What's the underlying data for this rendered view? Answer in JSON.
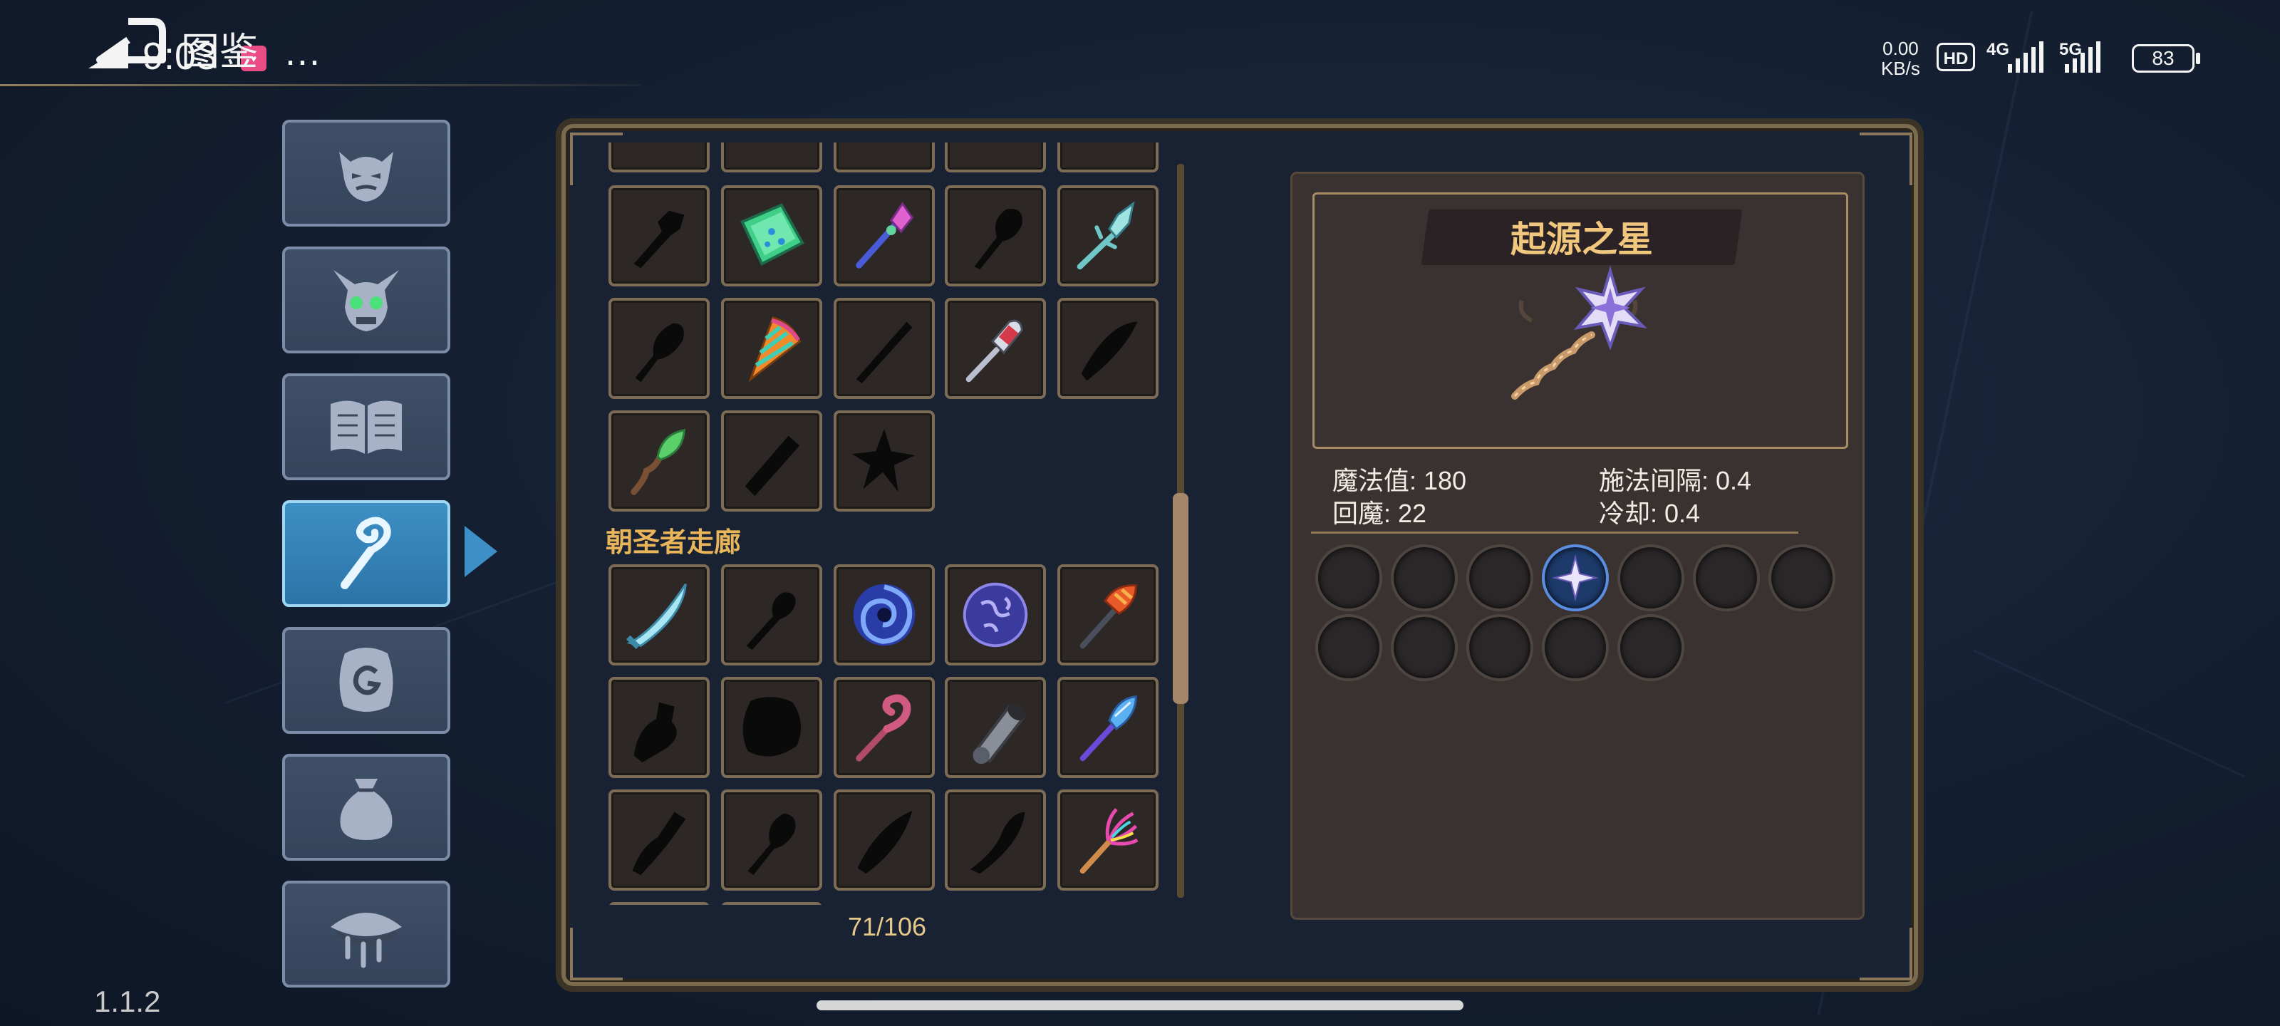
{
  "status_bar": {
    "time": "9:03",
    "dots": "...",
    "net_speed_value": "0.00",
    "net_speed_unit": "KB/s",
    "hd_badge": "HD",
    "sig1": "4G",
    "sig2": "5G",
    "battery": "83"
  },
  "header": {
    "title": "图鉴"
  },
  "version": "1.1.2",
  "tabs": [
    {
      "icon": "demon-face-icon",
      "active": false
    },
    {
      "icon": "horned-skull-icon",
      "active": false
    },
    {
      "icon": "open-book-icon",
      "active": false
    },
    {
      "icon": "staff-icon",
      "active": true
    },
    {
      "icon": "rune-hand-icon",
      "active": false
    },
    {
      "icon": "pouch-icon",
      "active": false
    },
    {
      "icon": "weeping-eye-icon",
      "active": false
    }
  ],
  "collection": {
    "section_title": "朝圣者走廊",
    "counter": "71/106"
  },
  "detail": {
    "name": "起源之星",
    "stats": {
      "mana_label": "魔法值: 180",
      "cast_interval_label": "施法间隔: 0.4",
      "mana_regen_label": "回魔: 22",
      "cooldown_label": "冷却: 0.4"
    },
    "sockets_total": 12,
    "socket_filled_index": 3
  },
  "colors": {
    "accent_gold": "#e9b55a",
    "tab_active": "#3d8fc4",
    "panel_border": "#7a6a4e"
  }
}
